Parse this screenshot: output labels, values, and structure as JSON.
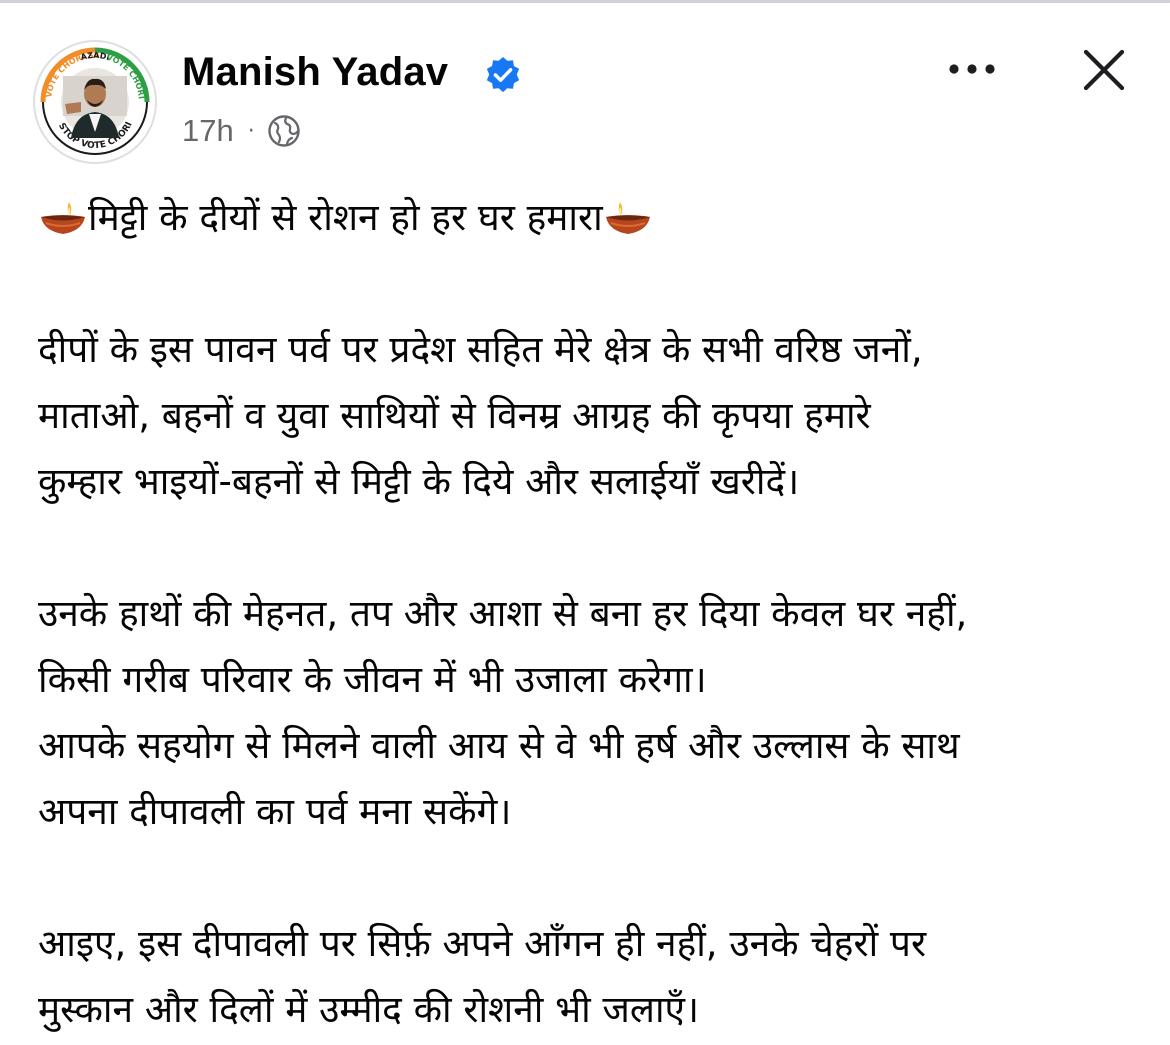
{
  "post": {
    "author_name": "Manish Yadav",
    "timestamp": "17h",
    "separator": "·",
    "avatar_ring_text": {
      "top_left": "VOTE CHORI SE",
      "top_center": "AZADI",
      "top_right": "VOTE CHORI SE",
      "bottom": "STOP VOTE CHORI"
    },
    "heading": "मिट्टी के दीयों से रोशन हो हर घर हमारा",
    "paragraphs": {
      "p1_l1": "दीपों के इस पावन पर्व पर प्रदेश सहित मेरे क्षेत्र के सभी वरिष्ठ जनों,",
      "p1_l2": "माताओ, बहनों व युवा साथियों से विनम्र आग्रह की कृपया हमारे",
      "p1_l3": "कुम्हार भाइयों-बहनों से मिट्टी के दिये और सलाईयाँ खरीदें।",
      "p2_l1": "उनके हाथों की मेहनत, तप और आशा से बना हर दिया केवल घर नहीं,",
      "p2_l2": "किसी गरीब परिवार के जीवन में भी उजाला करेगा।",
      "p2_l3": "आपके सहयोग से मिलने वाली आय से वे भी हर्ष और उल्लास के साथ",
      "p2_l4": "अपना दीपावली का पर्व मना सकेंगे।",
      "p3_l1": "आइए, इस दीपावली पर सिर्फ़ अपने आँगन ही नहीं, उनके चेहरों पर",
      "p3_l2": "मुस्कान और दिलों में उम्मीद की रोशनी भी जलाएँ।"
    }
  },
  "icons": {
    "verified": "verified-badge-icon",
    "audience": "globe-icon",
    "more": "more-options-icon",
    "close": "close-icon",
    "diya": "diya-emoji-icon"
  },
  "colors": {
    "verified_blue": "#1877f2",
    "meta_gray": "#65676b",
    "text": "#050505",
    "ring_orange": "#f28c28",
    "ring_green": "#2e9e44"
  }
}
